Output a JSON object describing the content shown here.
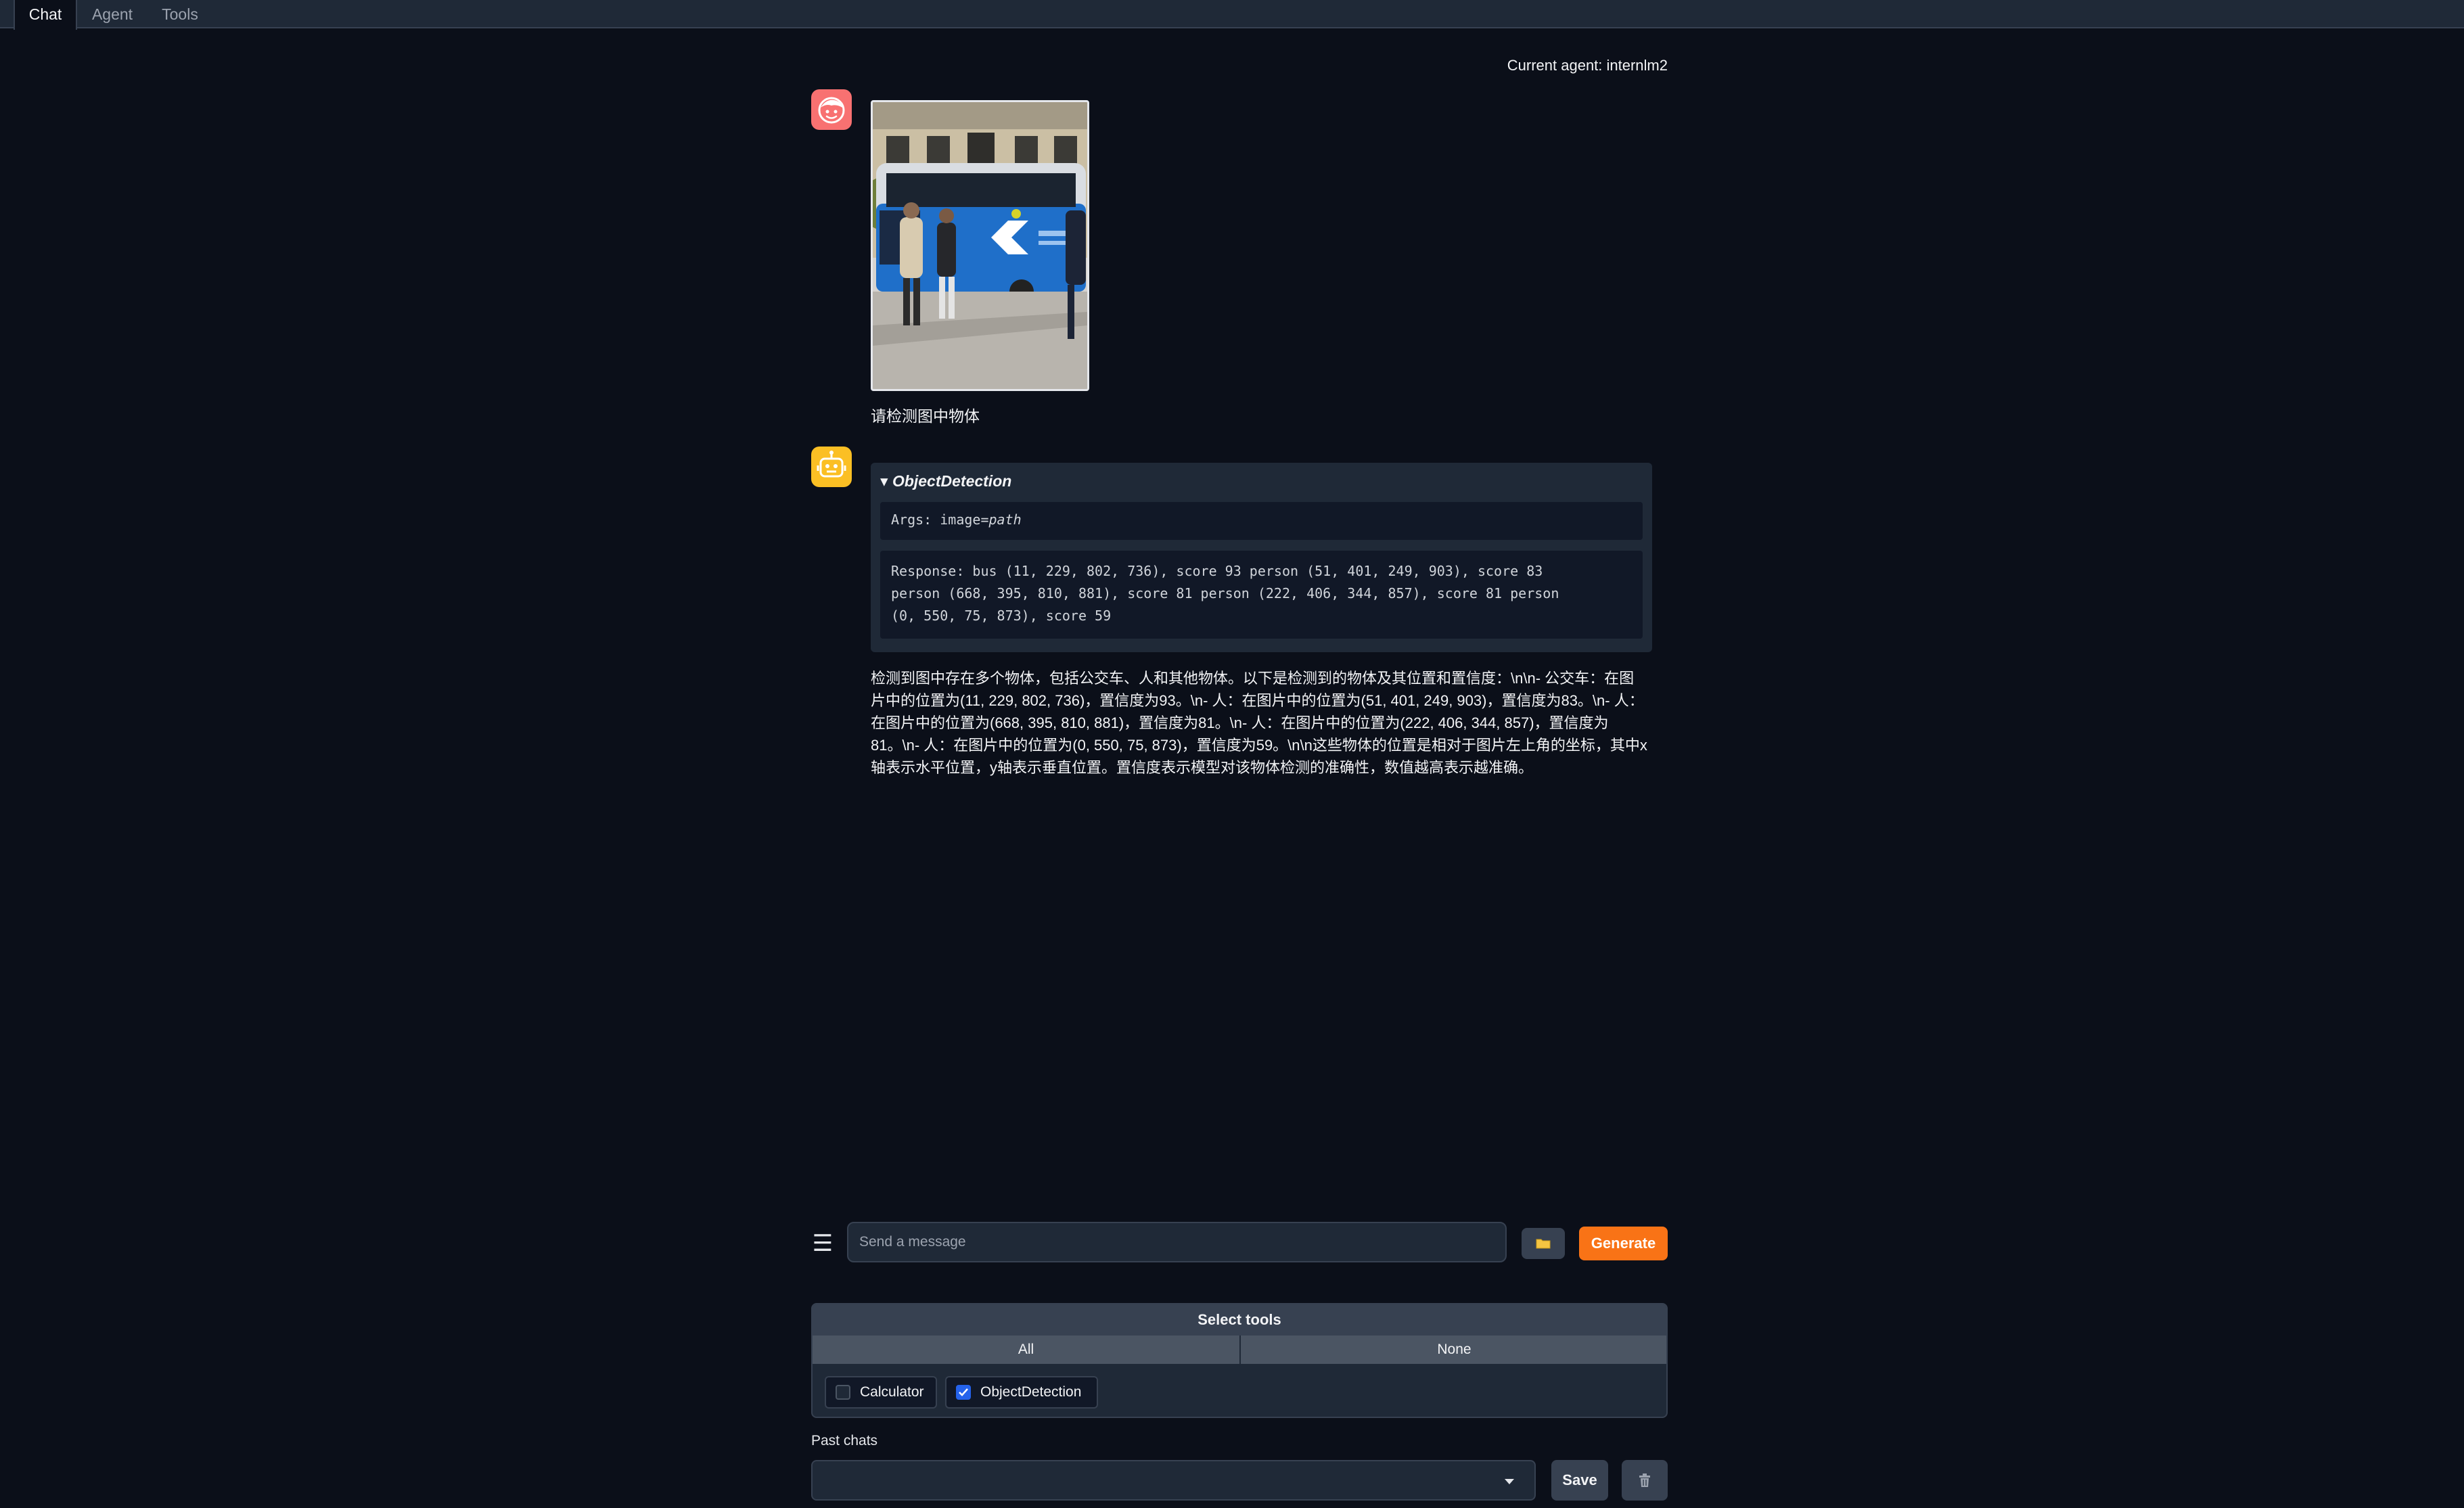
{
  "tabs": [
    {
      "label": "Chat",
      "active": true
    },
    {
      "label": "Agent",
      "active": false
    },
    {
      "label": "Tools",
      "active": false
    }
  ],
  "current_agent": "Current agent: internlm2",
  "conversation": {
    "user_message": {
      "image_description_icon": "photo",
      "text": "请检测图中物体"
    },
    "tool_call": {
      "name": "ObjectDetection",
      "args_prefix": "Args: image=",
      "args_value": "path",
      "response_lines": [
        "Response: bus (11, 229, 802, 736), score 93 person (51, 401, 249, 903), score 83",
        "person (668, 395, 810, 881), score 81 person (222, 406, 344, 857), score 81 person",
        "(0, 550, 75, 873), score 59"
      ]
    },
    "assistant_answer": "检测到图中存在多个物体，包括公交车、人和其他物体。以下是检测到的物体及其位置和置信度：\\n\\n- 公交车：在图片中的位置为(11, 229, 802, 736)，置信度为93。\\n- 人：在图片中的位置为(51, 401, 249, 903)，置信度为83。\\n- 人：在图片中的位置为(668, 395, 810, 881)，置信度为81。\\n- 人：在图片中的位置为(222, 406, 344, 857)，置信度为81。\\n- 人：在图片中的位置为(0, 550, 75, 873)，置信度为59。\\n\\n这些物体的位置是相对于图片左上角的坐标，其中x轴表示水平位置，y轴表示垂直位置。置信度表示模型对该物体检测的准确性，数值越高表示越准确。"
  },
  "input": {
    "placeholder": "Send a message",
    "value": "",
    "menu_icon": "hamburger-icon",
    "upload_icon": "folder-icon",
    "generate_label": "Generate"
  },
  "tools_panel": {
    "title": "Select tools",
    "all_label": "All",
    "none_label": "None",
    "tools": [
      {
        "label": "Calculator",
        "checked": false
      },
      {
        "label": "ObjectDetection",
        "checked": true
      }
    ]
  },
  "past_chats": {
    "label": "Past chats",
    "selected": "",
    "save_label": "Save",
    "delete_icon": "trash-icon"
  },
  "colors": {
    "background": "#0b0f19",
    "accent": "#f97316",
    "user_avatar": "#f87171",
    "bot_avatar": "#fbbf24",
    "checkbox": "#2563eb"
  }
}
